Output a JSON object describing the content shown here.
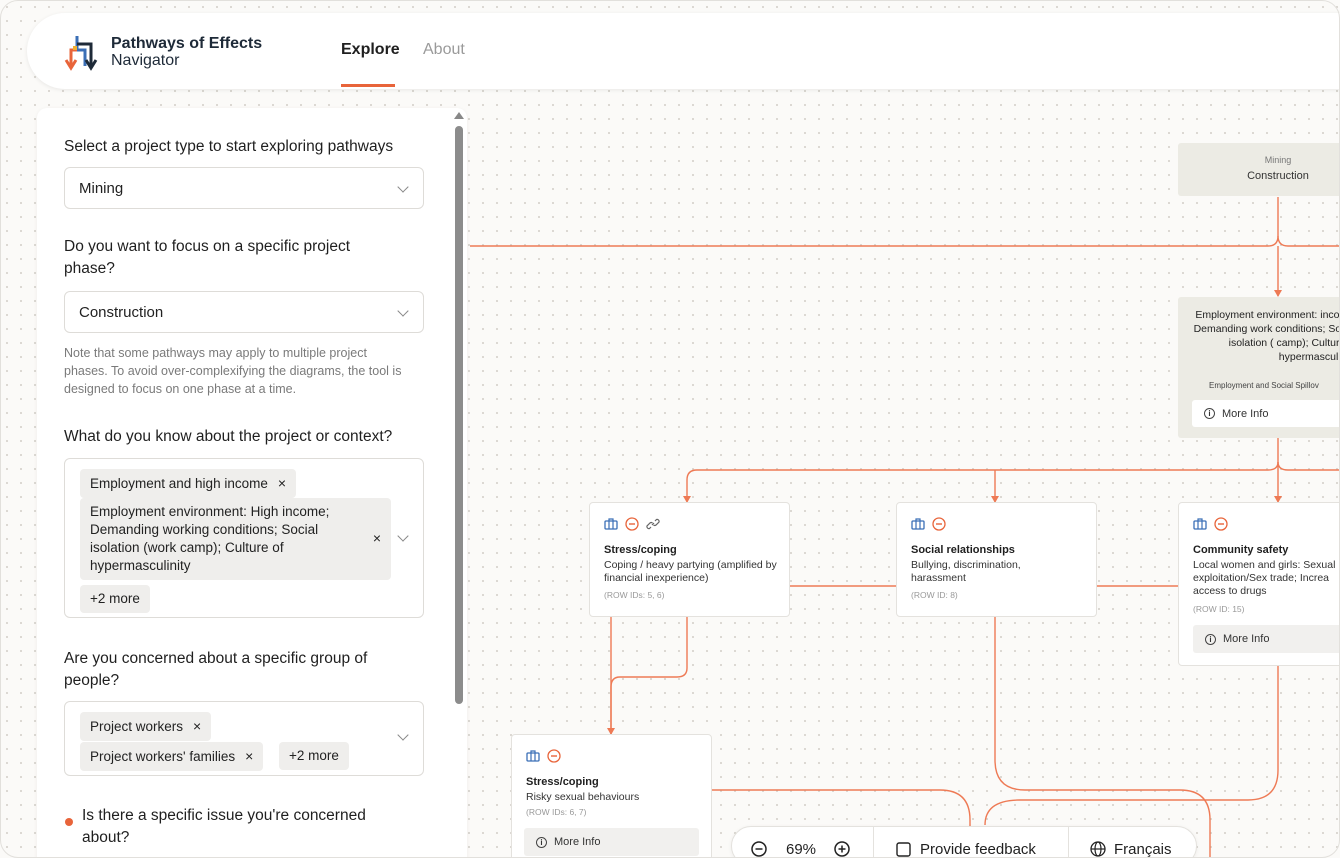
{
  "app": {
    "title_line1": "Pathways of Effects",
    "title_line2": "Navigator"
  },
  "nav": {
    "explore": "Explore",
    "about": "About"
  },
  "panel": {
    "q_project_type": "Select a project type to start exploring pathways",
    "project_type_value": "Mining",
    "q_phase": "Do you want to focus on a specific project phase?",
    "phase_value": "Construction",
    "phase_note": "Note that some pathways may apply to multiple project phases. To avoid over-complexifying the diagrams, the tool is designed to focus on one phase at a time.",
    "q_context": "What do you know about the project or context?",
    "context_chips": [
      "Employment and high income",
      "Employment environment: High income; Demanding working conditions; Social isolation (work camp); Culture of hypermasculinity"
    ],
    "context_more": "+2 more",
    "q_group": "Are you concerned about a specific group of people?",
    "group_chips": [
      "Project workers",
      "Project workers' families"
    ],
    "group_more": "+2 more",
    "q_issue": "Is there a specific issue you're concerned about?",
    "chip_remove": "×"
  },
  "diagram": {
    "root": {
      "line1": "Mining",
      "line2": "Construction"
    },
    "env_node": {
      "text": "Employment environment: income; Demanding work conditions; Social isolation ( camp); Culture of hypermasculinity",
      "category": "Employment and Social Spillov",
      "more": "More Info"
    },
    "nodes": [
      {
        "title": "Stress/coping",
        "desc": "Coping / heavy partying (amplified by financial inexperience)",
        "rows": "(ROW IDs: 5, 6)"
      },
      {
        "title": "Social relationships",
        "desc": "Bullying, discrimination, harassment",
        "rows": "(ROW ID: 8)"
      },
      {
        "title": "Community safety",
        "desc": "Local women and girls: Sexual exploitation/Sex trade; Increa access to drugs",
        "rows": "(ROW ID: 15)",
        "more": "More Info"
      },
      {
        "title": "Stress/coping",
        "desc": "Risky sexual behaviours",
        "rows": "(ROW IDs: 6, 7)",
        "more": "More Info"
      }
    ]
  },
  "toolbar": {
    "zoom": "69%",
    "feedback": "Provide feedback",
    "language": "Français"
  },
  "colors": {
    "accent": "#e8643a",
    "icon_blue": "#3b6fb6"
  }
}
